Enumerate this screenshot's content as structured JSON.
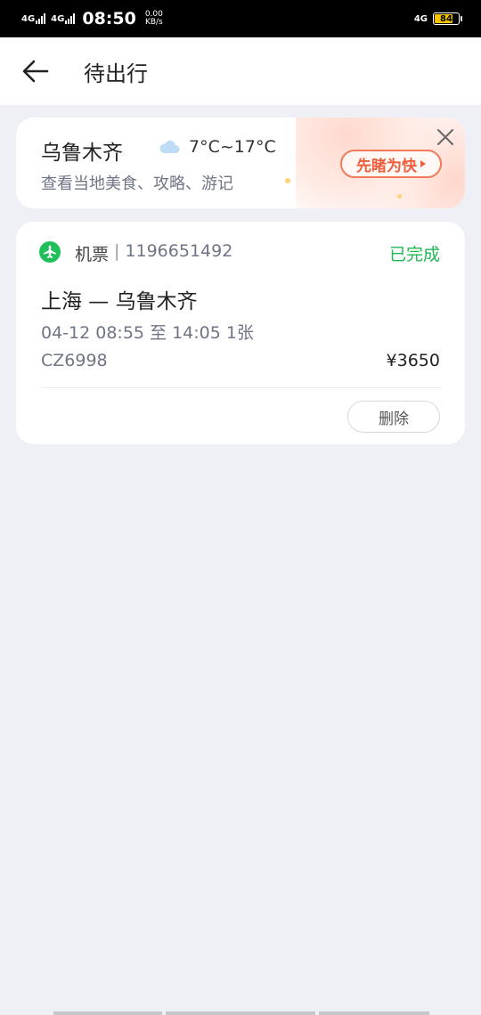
{
  "status_bar": {
    "net1": "4G",
    "net2": "4G",
    "time": "08:50",
    "speed_value": "0.00",
    "speed_unit": "KB/s",
    "net3": "4G",
    "battery": "84"
  },
  "header": {
    "title": "待出行"
  },
  "weather_card": {
    "city": "乌鲁木齐",
    "temperature": "7°C~17°C",
    "links": "查看当地美食、攻略、游记",
    "promo_label": "先睹为快"
  },
  "order": {
    "type": "机票",
    "separator": "|",
    "order_number": "1196651492",
    "status": "已完成",
    "route": "上海 — 乌鲁木齐",
    "schedule": "04-12 08:55 至 14:05   1张",
    "flight_no": "CZ6998",
    "price": "¥3650",
    "delete_label": "删除"
  },
  "colors": {
    "status_green": "#1fb954",
    "promo_red": "#ee5f3d",
    "page_bg": "#eff0f5"
  },
  "icons": {
    "back": "arrow-left-icon",
    "cloud": "cloud-icon",
    "close": "close-icon",
    "plane": "airplane-icon"
  }
}
